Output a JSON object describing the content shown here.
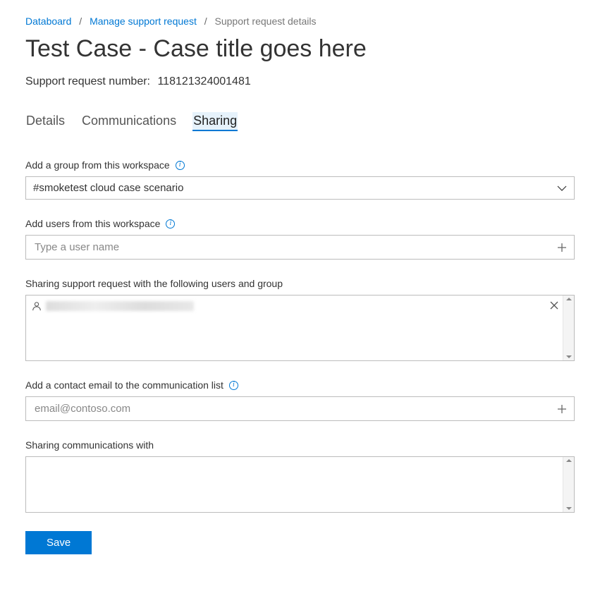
{
  "breadcrumb": {
    "items": [
      {
        "label": "Databoard",
        "link": true
      },
      {
        "label": "Manage support request",
        "link": true
      },
      {
        "label": "Support request details",
        "link": false
      }
    ]
  },
  "page": {
    "title": "Test Case - Case title goes here",
    "request_label": "Support request number:",
    "request_number": "118121324001481"
  },
  "tabs": {
    "items": [
      {
        "label": "Details",
        "active": false
      },
      {
        "label": "Communications",
        "active": false
      },
      {
        "label": "Sharing",
        "active": true
      }
    ]
  },
  "fields": {
    "group": {
      "label": "Add a group from this workspace",
      "selected": "#smoketest cloud case scenario"
    },
    "users": {
      "label": "Add users from this workspace",
      "placeholder": "Type a user name"
    },
    "sharing_list": {
      "label": "Sharing support request with the following users and group"
    },
    "contact_email": {
      "label": "Add a contact email to the communication list",
      "placeholder": "email@contoso.com"
    },
    "sharing_comm": {
      "label": "Sharing communications with"
    }
  },
  "buttons": {
    "save": "Save"
  }
}
